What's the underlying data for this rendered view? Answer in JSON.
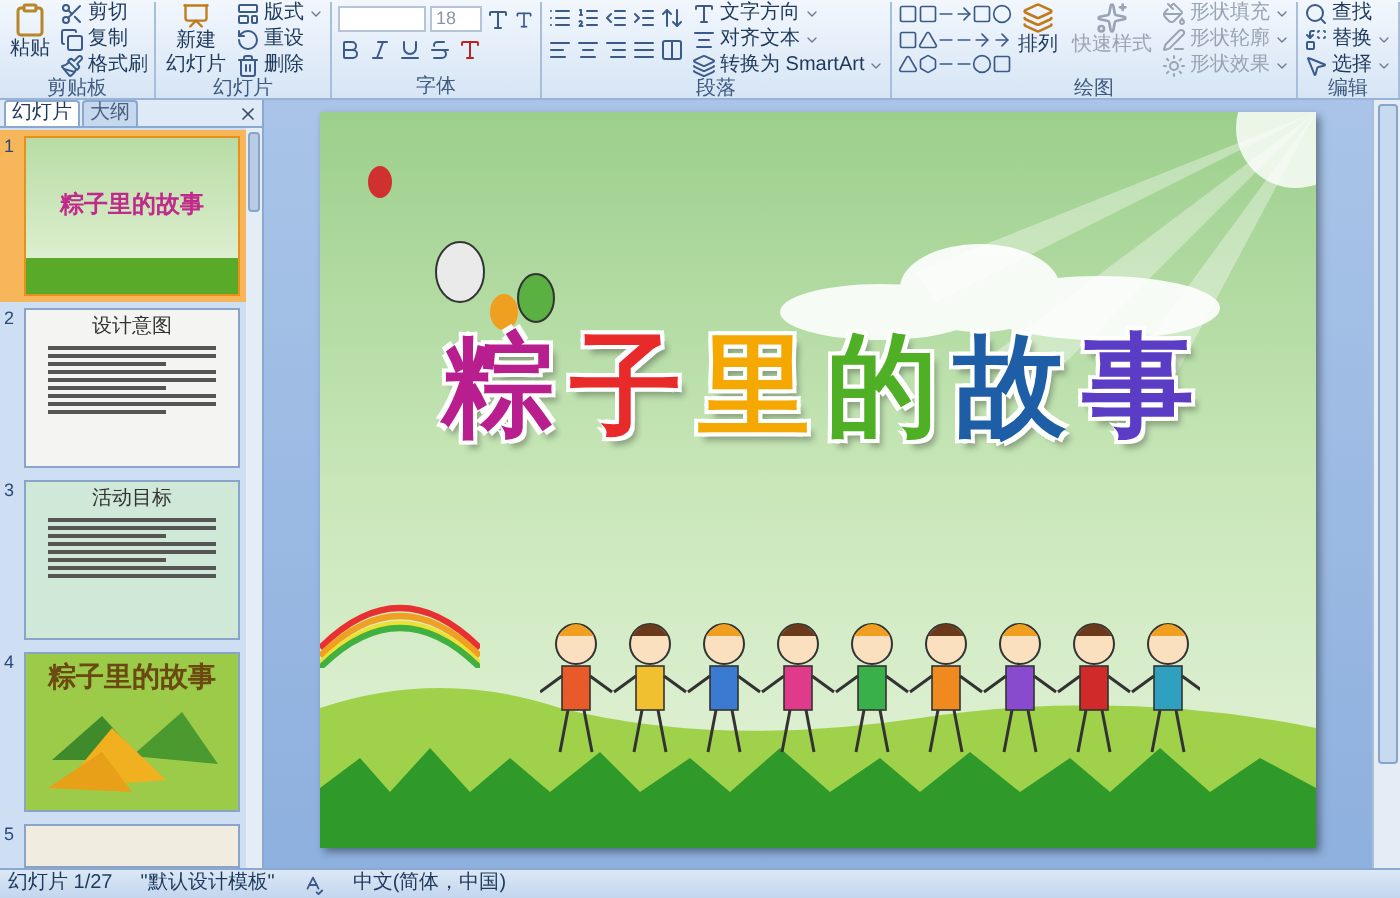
{
  "ribbon": {
    "groups": [
      {
        "kind": "clipboard",
        "label": "剪贴板",
        "large": [
          {
            "lines": [
              "粘贴"
            ]
          }
        ],
        "small": [
          {
            "label": "剪切"
          },
          {
            "label": "复制"
          },
          {
            "label": "格式刷"
          }
        ]
      },
      {
        "kind": "slides",
        "label": "幻灯片",
        "large": [
          {
            "lines": [
              "新建",
              "幻灯片"
            ]
          }
        ],
        "small": [
          {
            "label": "版式"
          },
          {
            "label": "重设"
          },
          {
            "label": "删除"
          }
        ]
      },
      {
        "kind": "font",
        "label": "字体",
        "font_size": "18"
      },
      {
        "kind": "paragraph",
        "label": "段落",
        "small": [
          {
            "label": "文字方向"
          },
          {
            "label": "对齐文本"
          },
          {
            "label": "转换为 SmartArt"
          }
        ]
      },
      {
        "kind": "drawing",
        "label": "绘图",
        "large": [
          {
            "lines": [
              "排列"
            ],
            "disabled": false
          },
          {
            "lines": [
              "快速样式"
            ],
            "disabled": true
          }
        ],
        "small": [
          {
            "label": "形状填充",
            "disabled": true
          },
          {
            "label": "形状轮廓",
            "disabled": true
          },
          {
            "label": "形状效果",
            "disabled": true
          }
        ]
      },
      {
        "kind": "editing",
        "label": "编辑",
        "small": [
          {
            "label": "查找"
          },
          {
            "label": "替换"
          },
          {
            "label": "选择"
          }
        ]
      }
    ]
  },
  "panel": {
    "tabs": [
      {
        "label": "幻灯片",
        "selected": true
      },
      {
        "label": "大纲",
        "selected": false
      }
    ],
    "slides": [
      {
        "number": "1",
        "kind": "title",
        "title": "粽子里的故事",
        "selected": true
      },
      {
        "number": "2",
        "kind": "text",
        "title": "设计意图",
        "selected": false
      },
      {
        "number": "3",
        "kind": "goals",
        "title": "活动目标",
        "selected": false
      },
      {
        "number": "4",
        "kind": "zongzi",
        "title": "粽子里的故事",
        "selected": false
      },
      {
        "number": "5",
        "kind": "partial",
        "selected": false
      }
    ]
  },
  "slide": {
    "title": [
      {
        "char": "粽",
        "color": "#b81e8e"
      },
      {
        "char": "子",
        "color": "#e82a2a"
      },
      {
        "char": "里",
        "color": "#f5a800"
      },
      {
        "char": "的",
        "color": "#4fb025"
      },
      {
        "char": "故",
        "color": "#1d5ea6"
      },
      {
        "char": "事",
        "color": "#5b3cc4"
      }
    ]
  },
  "status_bar": {
    "slide": "幻灯片 1/27",
    "theme": "\"默认设计模板\"",
    "language": "中文(简体，中国)"
  }
}
